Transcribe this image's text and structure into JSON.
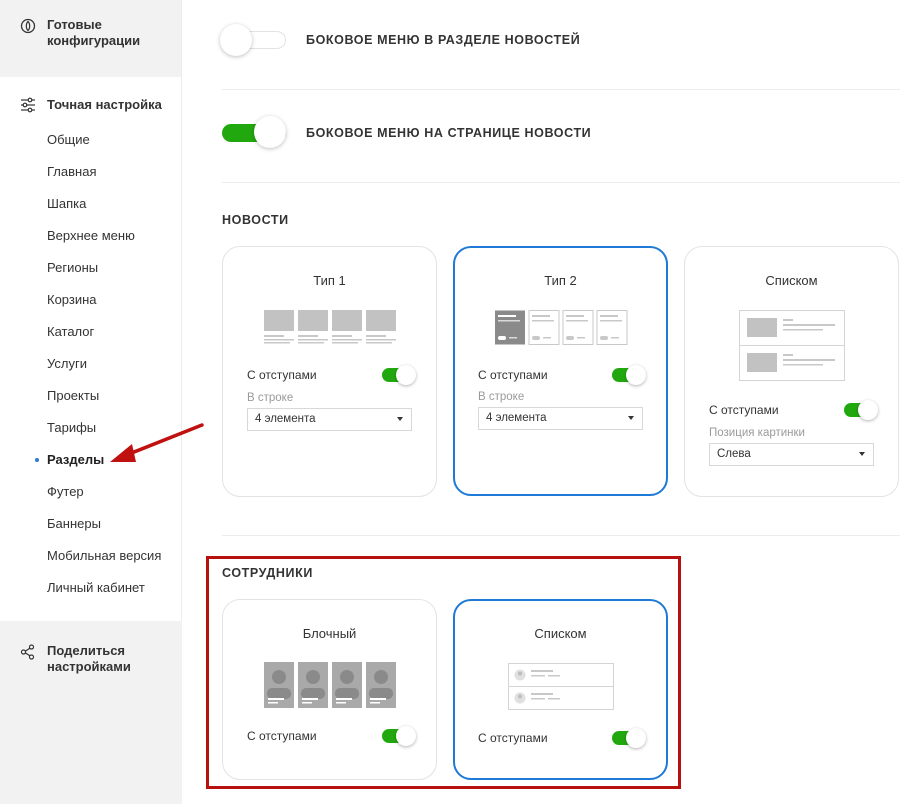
{
  "sidebar": {
    "ready_configs": "Готовые конфигурации",
    "fine_tune": "Точная настройка",
    "items": [
      "Общие",
      "Главная",
      "Шапка",
      "Верхнее меню",
      "Регионы",
      "Корзина",
      "Каталог",
      "Услуги",
      "Проекты",
      "Тарифы",
      "Разделы",
      "Футер",
      "Баннеры",
      "Мобильная версия",
      "Личный кабинет"
    ],
    "active_item": "Разделы",
    "share": "Поделиться настройками"
  },
  "main": {
    "toggle1": {
      "label": "БОКОВОЕ МЕНЮ В РАЗДЕЛЕ НОВОСТЕЙ",
      "on": false
    },
    "toggle2": {
      "label": "БОКОВОЕ МЕНЮ НА СТРАНИЦЕ НОВОСТИ",
      "on": true
    },
    "news": {
      "title": "НОВОСТИ",
      "cards": [
        {
          "title": "Тип 1",
          "option": "С отступами",
          "sub_label": "В строке",
          "select": "4 элемента",
          "selected": false
        },
        {
          "title": "Тип 2",
          "option": "С отступами",
          "sub_label": "В строке",
          "select": "4 элемента",
          "selected": true
        },
        {
          "title": "Списком",
          "option": "С отступами",
          "sub_label": "Позиция картинки",
          "select": "Слева",
          "selected": false
        }
      ]
    },
    "staff": {
      "title": "СОТРУДНИКИ",
      "cards": [
        {
          "title": "Блочный",
          "option": "С отступами",
          "selected": false
        },
        {
          "title": "Списком",
          "option": "С отступами",
          "selected": true
        }
      ]
    }
  },
  "colors": {
    "accent": "#22a80f",
    "selected_border": "#1e7ad6",
    "highlight": "#b80f0f",
    "arrow": "#c01010"
  }
}
